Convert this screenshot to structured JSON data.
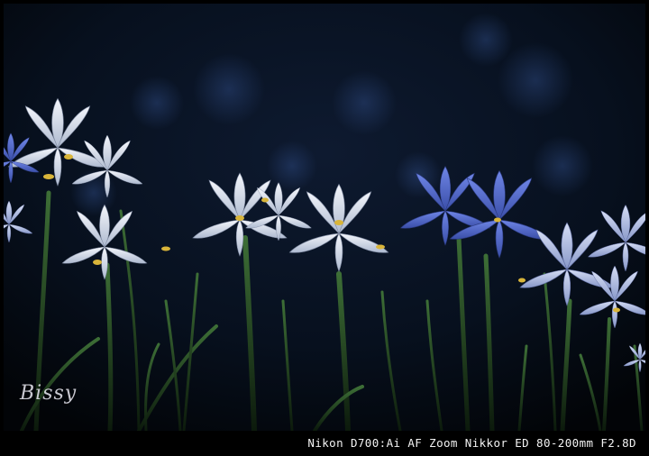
{
  "photo": {
    "signature": "Bissy",
    "caption": "Nikon D700:Ai AF Zoom Nikkor ED 80-200mm F2.8D",
    "colors": {
      "background": "#04080f",
      "bokeh": "#1b2f55",
      "white_petal": "#e6ebf3",
      "blue_petal": "#5a6fd0",
      "yellow_accent": "#d9b53a",
      "stem": "#2f5a2a"
    },
    "subject_icons": [
      "white-iris-icon",
      "blue-iris-icon",
      "grass-blade-icon",
      "bokeh-light-icon"
    ]
  }
}
